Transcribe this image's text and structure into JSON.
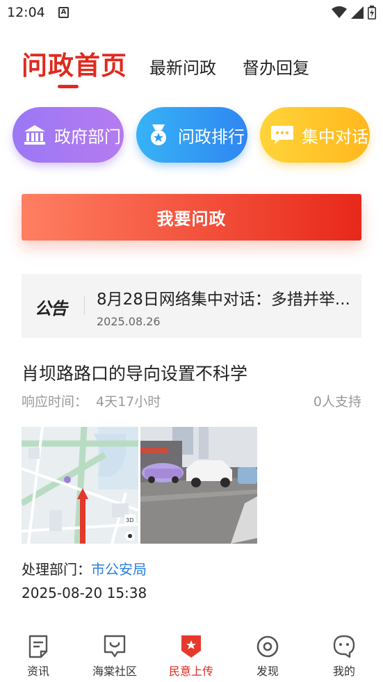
{
  "status_bar": {
    "time": "12:04",
    "notification_letter": "A",
    "icons": [
      "wifi-icon",
      "signal-icon",
      "battery-icon"
    ]
  },
  "tabs": [
    {
      "label": "问政首页",
      "active": true
    },
    {
      "label": "最新问政",
      "active": false
    },
    {
      "label": "督办回复",
      "active": false
    }
  ],
  "quick_actions": [
    {
      "label": "政府部门",
      "icon": "government-building-icon"
    },
    {
      "label": "问政排行",
      "icon": "medal-icon"
    },
    {
      "label": "集中对话",
      "icon": "chat-bubble-icon"
    }
  ],
  "ask_button": {
    "label": "我要问政"
  },
  "notice": {
    "badge": "公告",
    "title": "8月28日网络集中对话：多措并举...",
    "date": "2025.08.26"
  },
  "post": {
    "title": "肖坝路路口的导向设置不科学",
    "response_label": "响应时间：",
    "response_value": "4天17小时",
    "support": "0人支持",
    "images": [
      "map-screenshot",
      "street-photo"
    ],
    "map_badge": "3D",
    "dept_label": "处理部门：",
    "dept_value": "市公安局",
    "time": "2025-08-20 15:38"
  },
  "bottom_nav": [
    {
      "label": "资讯",
      "icon": "news-icon",
      "active": false
    },
    {
      "label": "海棠社区",
      "icon": "community-icon",
      "active": false
    },
    {
      "label": "民意上传",
      "icon": "upload-shield-icon",
      "active": true
    },
    {
      "label": "发现",
      "icon": "discover-icon",
      "active": false
    },
    {
      "label": "我的",
      "icon": "profile-icon",
      "active": false
    }
  ],
  "colors": {
    "accent": "#e02a1f",
    "link": "#2a7fe0",
    "gov_gradient": [
      "#9b78f5",
      "#b57bf0"
    ],
    "rank_gradient": [
      "#37b3f5",
      "#2f86f2"
    ],
    "dialog_gradient": [
      "#ffd43a",
      "#ffb81c"
    ]
  }
}
